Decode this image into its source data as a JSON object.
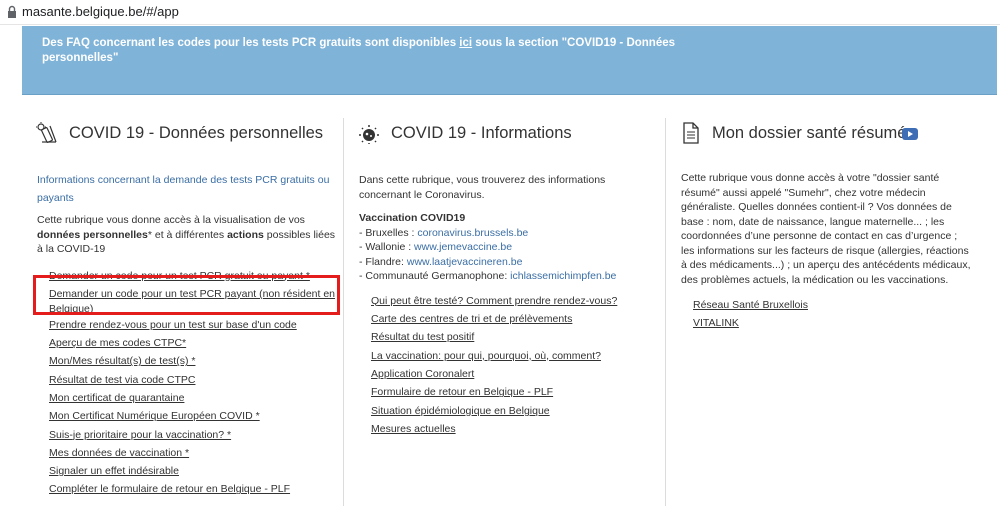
{
  "browser": {
    "url": "masante.belgique.be/#/app"
  },
  "banner": {
    "text_before": "Des FAQ concernant les codes pour les tests PCR gratuits sont disponibles ",
    "link_text": "ici",
    "text_after": " sous la section \"COVID19 - Données personnelles\""
  },
  "col1": {
    "title": "COVID 19 - Données personnelles",
    "info_link": "Informations concernant la demande des tests PCR gratuits ou payants",
    "desc_part1": "Cette rubrique vous donne accès à la visualisation de vos ",
    "desc_bold1": "données personnelles",
    "desc_part2": "* et à différentes ",
    "desc_bold2": "actions",
    "desc_part3": " possibles liées à la COVID-19",
    "links": [
      "Demander un code pour un test PCR gratuit ou payant *",
      "Demander un code pour un test PCR payant (non résident en Belgique)",
      "Prendre rendez-vous pour un test sur base d'un code",
      "Aperçu de mes codes CTPC*",
      "Mon/Mes résultat(s) de test(s) *",
      "Résultat de test via code CTPC",
      "Mon certificat de quarantaine",
      "Mon Certificat Numérique Européen COVID *",
      "Suis-je prioritaire pour la vaccination? *",
      "Mes données de vaccination *",
      "Signaler un effet indésirable",
      "Compléter le formulaire de retour en Belgique - PLF"
    ]
  },
  "col2": {
    "title": "COVID 19 - Informations",
    "desc": "Dans cette rubrique, vous trouverez des informations concernant le Coronavirus.",
    "vacc_title": "Vaccination COVID19",
    "regions": [
      {
        "label": "- Bruxelles : ",
        "link": "coronavirus.brussels.be"
      },
      {
        "label": "- Wallonie : ",
        "link": "www.jemevaccine.be"
      },
      {
        "label": "- Flandre: ",
        "link": "www.laatjevaccineren.be"
      },
      {
        "label": "- Communauté Germanophone: ",
        "link": "ichlassemichimpfen.be"
      }
    ],
    "links": [
      "Qui peut être testé? Comment prendre rendez-vous?",
      "Carte des centres de tri et de prélèvements",
      "Résultat du test positif",
      "La vaccination: pour qui, pourquoi, où, comment?",
      "Application Coronalert",
      "Formulaire de retour en Belgique - PLF",
      "Situation épidémiologique en Belgique",
      "Mesures actuelles"
    ]
  },
  "col3": {
    "title": "Mon dossier santé résumé",
    "desc": "Cette rubrique vous donne accès à votre \"dossier santé résumé\" aussi appelé \"Sumehr\", chez votre médecin généraliste. Quelles données contient-il ? Vos données de base : nom, date de naissance, langue maternelle... ; les coordonnées d’une personne de contact en cas d’urgence ; les informations sur les facteurs de risque (allergies, réactions à des médicaments...) ; un aperçu des antécédents médicaux, des problèmes actuels, la médication ou les vaccinations.",
    "links": [
      "Réseau Santé Bruxellois",
      "VITALINK"
    ]
  },
  "colors": {
    "banner": "#7fb3d8",
    "link_blue": "#3a6ea5",
    "highlight": "#e51c1c",
    "youtube": "#3d6db5"
  }
}
